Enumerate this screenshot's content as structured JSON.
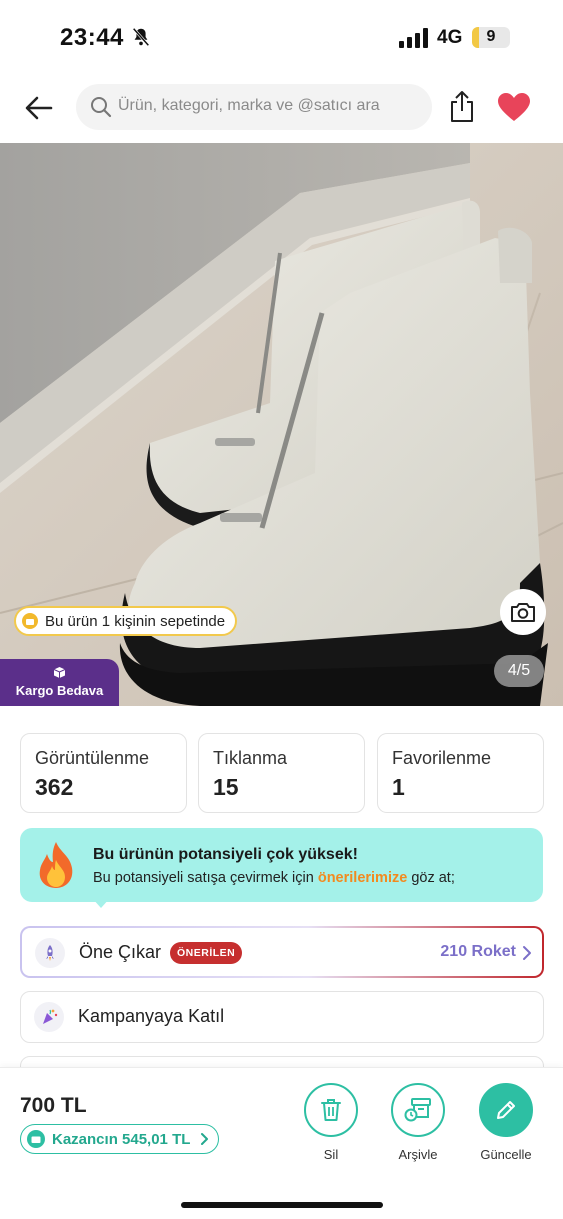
{
  "status_bar": {
    "time": "23:44",
    "network": "4G",
    "battery": "9",
    "battery_level": 0.09,
    "icons": [
      "bell-slash-icon",
      "signal-icon"
    ]
  },
  "header": {
    "search_placeholder": "Ürün, kategori, marka ve @satıcı ara",
    "icons": [
      "back-arrow-icon",
      "search-icon",
      "share-icon",
      "heart-icon"
    ],
    "heart_color": "#e8445a"
  },
  "product_image": {
    "basket_text": "Bu ürün 1 kişinin sepetinde",
    "page_indicator": "4/5",
    "shipping_label": "Kargo Bedava",
    "shipping_color": "#5b2f8a"
  },
  "stats": [
    {
      "label": "Görüntülenme",
      "value": "362"
    },
    {
      "label": "Tıklanma",
      "value": "15"
    },
    {
      "label": "Favorilenme",
      "value": "1"
    }
  ],
  "potential": {
    "title": "Bu ürünün potansiyeli çok yüksek!",
    "desc_before": "Bu potansiyeli satışa çevirmek için ",
    "desc_link": "önerilerimize",
    "desc_after": " göz at;",
    "background_color": "#a4f1e9"
  },
  "options": {
    "highlight": {
      "label": "Öne Çıkar",
      "badge": "ÖNERİLEN",
      "price": "210 Roket"
    },
    "campaign": {
      "label": "Kampanyaya Katıl"
    }
  },
  "bottom": {
    "price": "700 TL",
    "earning": "Kazancın 545,01 TL",
    "actions": [
      {
        "label": "Sil",
        "icon": "trash-icon"
      },
      {
        "label": "Arşivle",
        "icon": "archive-icon"
      },
      {
        "label": "Güncelle",
        "icon": "pencil-icon"
      }
    ],
    "accent_color": "#2dbfa3"
  }
}
